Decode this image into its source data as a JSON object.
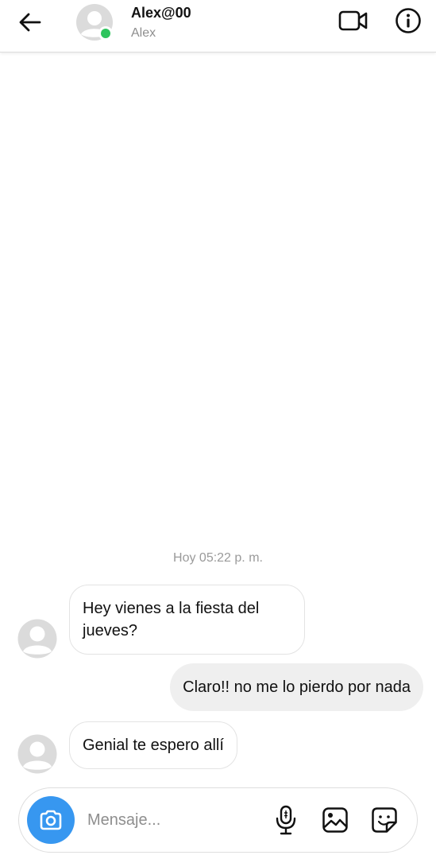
{
  "header": {
    "username": "Alex@00",
    "display_name": "Alex",
    "online_color": "#2ec45d",
    "icons": [
      "back-arrow-icon",
      "avatar-icon",
      "video-call-icon",
      "info-icon"
    ]
  },
  "conversation": {
    "timestamp": "Hoy 05:22 p. m.",
    "messages": [
      {
        "from": "Alex",
        "direction": "incoming",
        "text": "Hey vienes a la fiesta del jueves?"
      },
      {
        "from": "me",
        "direction": "outgoing",
        "text": "Claro!! no me lo pierdo por nada"
      },
      {
        "from": "Alex",
        "direction": "incoming",
        "text": "Genial te espero allí"
      }
    ]
  },
  "composer": {
    "placeholder": "Mensaje...",
    "camera_color": "#3797f0",
    "icons": [
      "camera-icon",
      "microphone-icon",
      "gallery-icon",
      "sticker-icon"
    ]
  }
}
